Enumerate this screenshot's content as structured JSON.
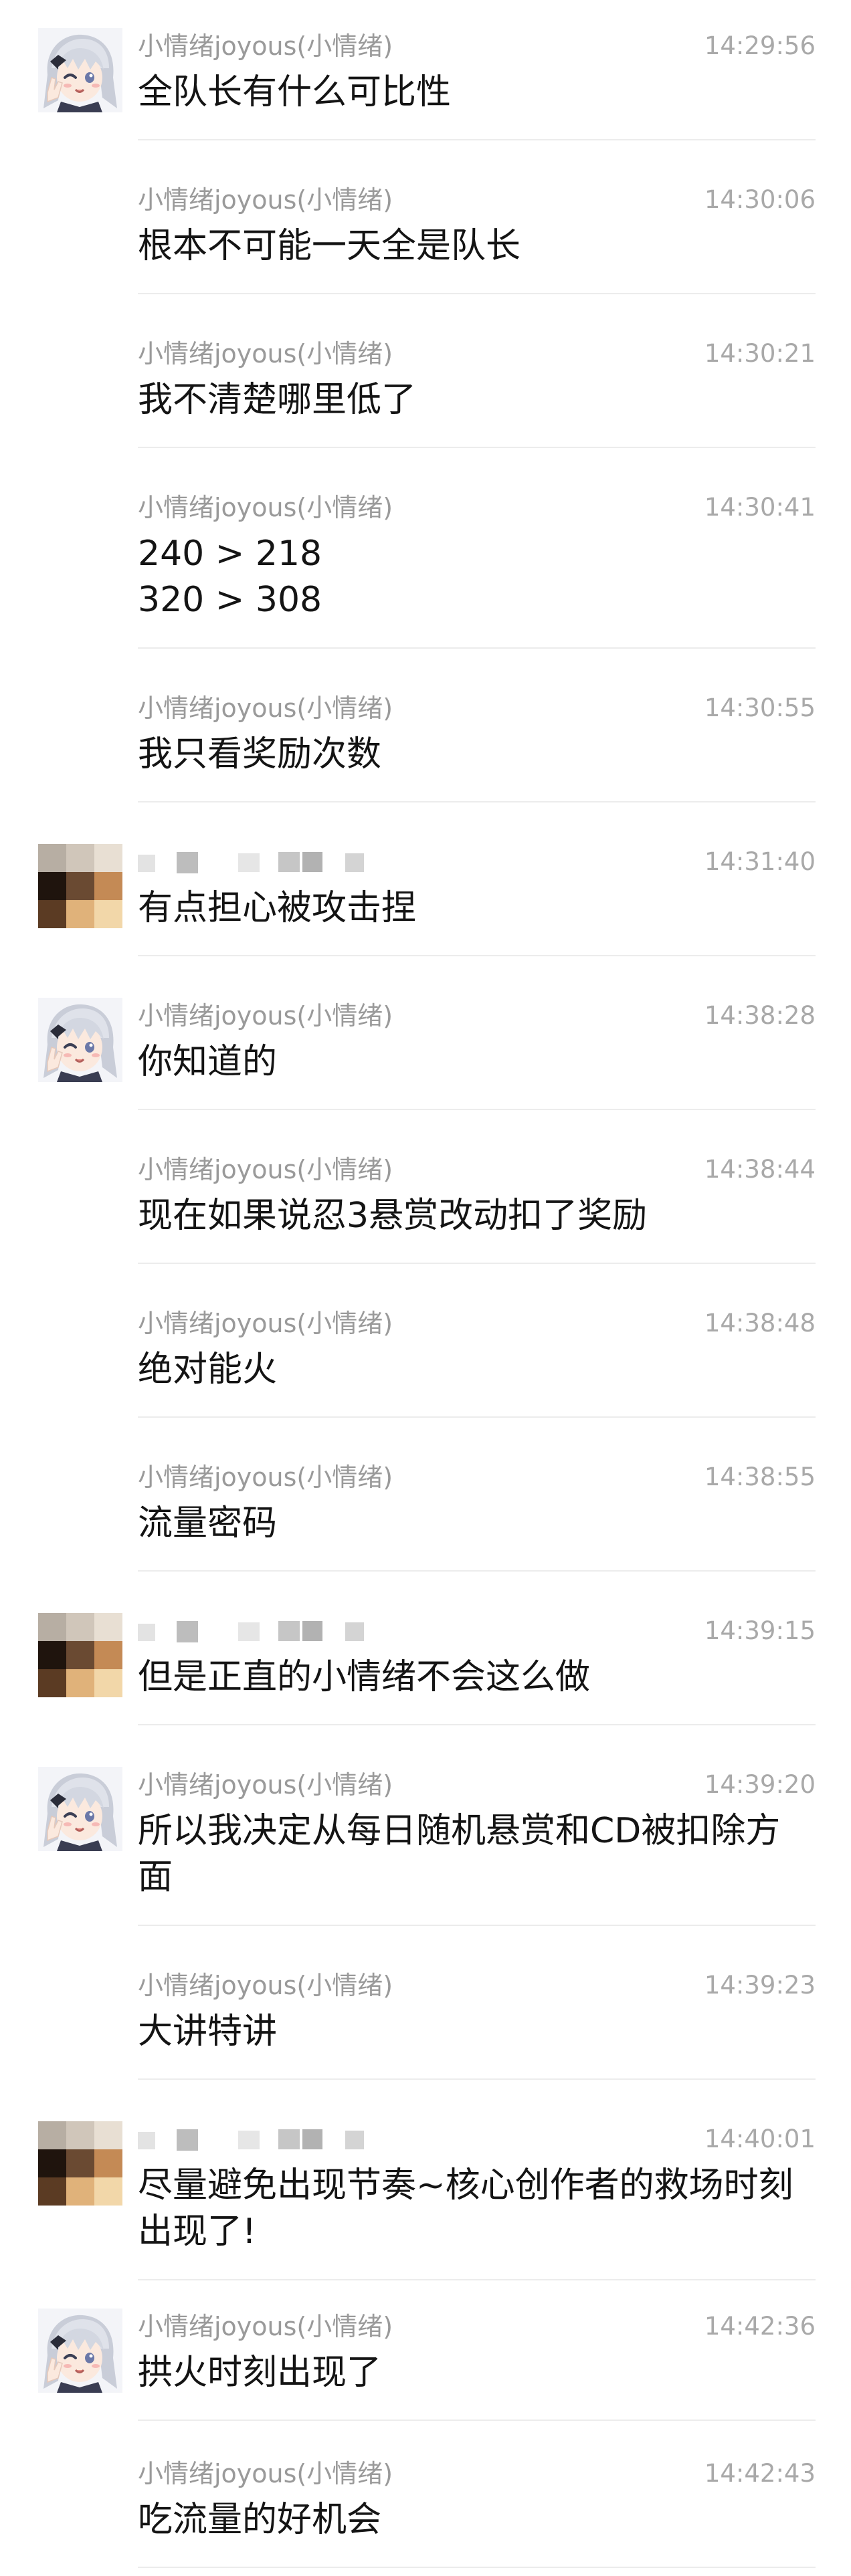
{
  "colors": {
    "sender_text": "#9a9a9a",
    "time_text": "#a9a9a9",
    "message_text": "#141414",
    "divider": "#ececec"
  },
  "messages": [
    {
      "sender": "小情绪joyous(小情绪)",
      "time": "14:29:56",
      "text": "全队长有什么可比性",
      "avatar": "anime-girl-avatar"
    },
    {
      "sender": "小情绪joyous(小情绪)",
      "time": "14:30:06",
      "text": "根本不可能一天全是队长"
    },
    {
      "sender": "小情绪joyous(小情绪)",
      "time": "14:30:21",
      "text": "我不清楚哪里低了"
    },
    {
      "sender": "小情绪joyous(小情绪)",
      "time": "14:30:41",
      "text": "240 > 218\n320 > 308"
    },
    {
      "sender": "小情绪joyous(小情绪)",
      "time": "14:30:55",
      "text": "我只看奖励次数"
    },
    {
      "sender": "",
      "time": "14:31:40",
      "text": "有点担心被攻击捏",
      "avatar": "pixelated-avatar"
    },
    {
      "sender": "小情绪joyous(小情绪)",
      "time": "14:38:28",
      "text": "你知道的",
      "avatar": "anime-girl-avatar"
    },
    {
      "sender": "小情绪joyous(小情绪)",
      "time": "14:38:44",
      "text": "现在如果说忍3悬赏改动扣了奖励"
    },
    {
      "sender": "小情绪joyous(小情绪)",
      "time": "14:38:48",
      "text": "绝对能火"
    },
    {
      "sender": "小情绪joyous(小情绪)",
      "time": "14:38:55",
      "text": "流量密码"
    },
    {
      "sender": "",
      "time": "14:39:15",
      "text": "但是正直的小情绪不会这么做",
      "avatar": "pixelated-avatar"
    },
    {
      "sender": "小情绪joyous(小情绪)",
      "time": "14:39:20",
      "text": "所以我决定从每日随机悬赏和CD被扣除方面",
      "avatar": "anime-girl-avatar"
    },
    {
      "sender": "小情绪joyous(小情绪)",
      "time": "14:39:23",
      "text": "大讲特讲"
    },
    {
      "sender": "",
      "time": "14:40:01",
      "text": "尽量避免出现节奏~核心创作者的救场时刻出现了!",
      "avatar": "pixelated-avatar"
    },
    {
      "sender": "小情绪joyous(小情绪)",
      "time": "14:42:36",
      "text": "拱火时刻出现了",
      "avatar": "anime-girl-avatar"
    },
    {
      "sender": "小情绪joyous(小情绪)",
      "time": "14:42:43",
      "text": "吃流量的好机会"
    }
  ]
}
